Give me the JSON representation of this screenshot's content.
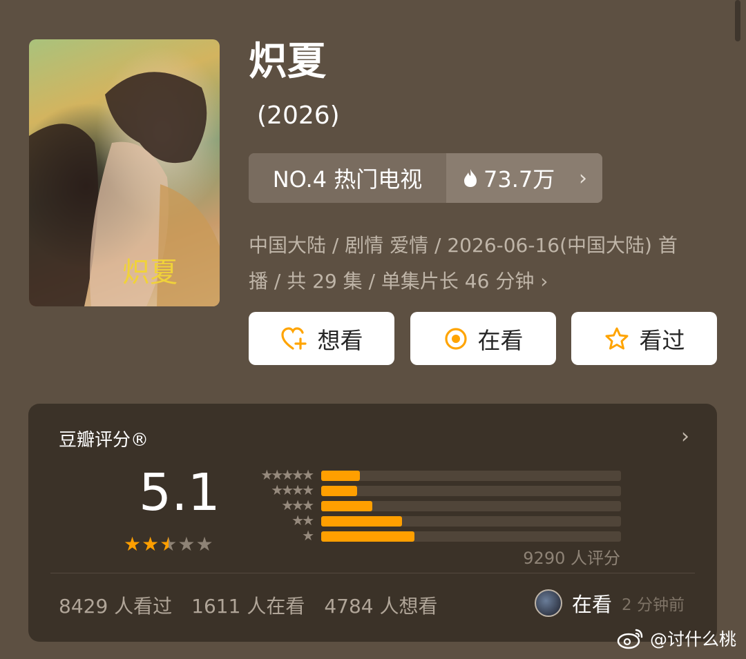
{
  "movie": {
    "title": "炽夏",
    "year": "(2026)",
    "poster_text": "炽夏"
  },
  "rank": {
    "label": "NO.4 热门电视",
    "heat": "73.7万"
  },
  "info": {
    "line1": "中国大陆 / 剧情 爱情 / 2026-06-16(中国大陆) 首",
    "line2": "播 / 共 29 集 / 单集片长 46 分钟"
  },
  "actions": {
    "want": "想看",
    "watching": "在看",
    "watched": "看过"
  },
  "rating": {
    "title": "豆瓣评分®",
    "score": "5.1",
    "stars": 2.5,
    "distribution": [
      {
        "stars": 5,
        "fraction": 0.13
      },
      {
        "stars": 4,
        "fraction": 0.12
      },
      {
        "stars": 3,
        "fraction": 0.17
      },
      {
        "stars": 2,
        "fraction": 0.27
      },
      {
        "stars": 1,
        "fraction": 0.31
      }
    ],
    "raters": "9290 人评分",
    "watched": "8429 人看过",
    "watching": "1611 人在看",
    "want": "4784 人想看"
  },
  "friend": {
    "status": "在看",
    "time": "2 分钟前"
  },
  "watermark": "@讨什么桃",
  "colors": {
    "accent": "#ff9f00",
    "background": "#5d5042",
    "card": "#3b3228"
  }
}
